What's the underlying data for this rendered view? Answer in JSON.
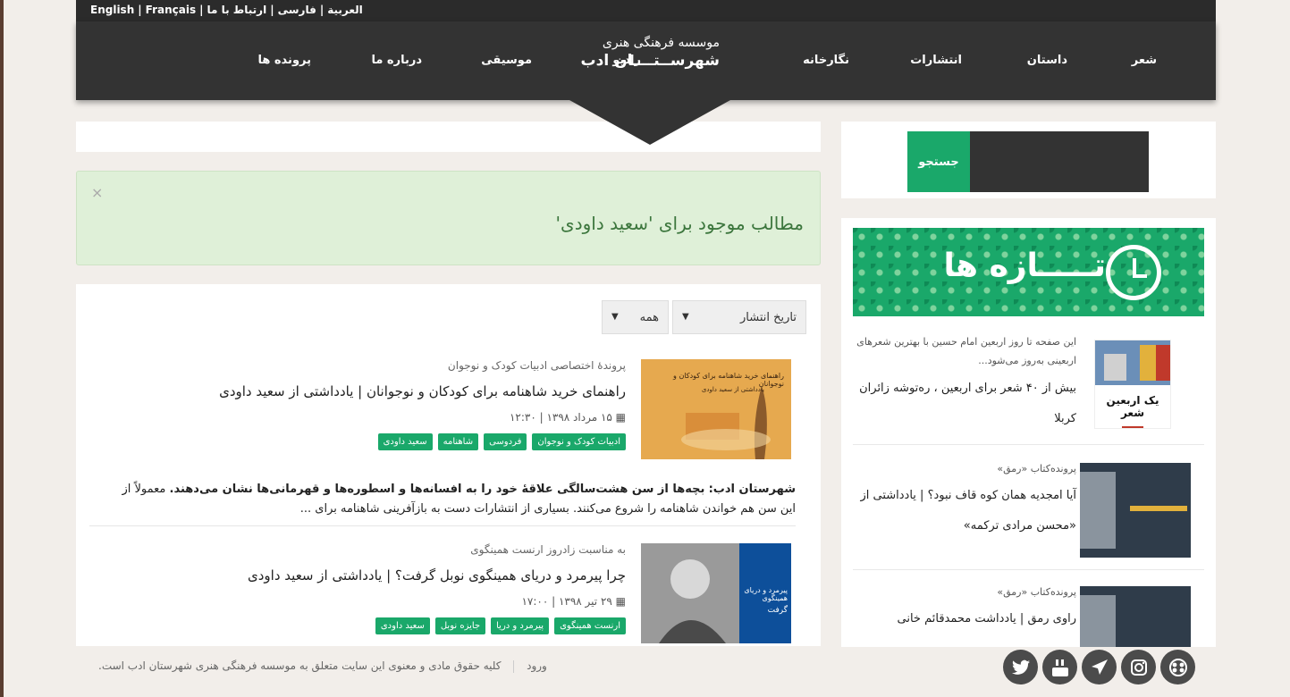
{
  "topbar": {
    "languages": [
      "English",
      "Français",
      "العربية",
      "فارسی"
    ],
    "contact": "ارتباط با ما"
  },
  "nav": {
    "items": [
      "شعر",
      "داستان",
      "انتشارات",
      "نگارخانه",
      "رادیو",
      "موسیقی",
      "درباره ما",
      "پرونده ها"
    ],
    "logo_line1": "موسسه فرهنگی هنری",
    "logo_line2": "شهرســتــــان ادب"
  },
  "search": {
    "button_label": "جستجو"
  },
  "alert": {
    "close": "×",
    "message": "مطالب موجود برای 'سعید داودی'"
  },
  "filters": {
    "sort": "تاریخ انتشار",
    "category": "همه"
  },
  "articles": [
    {
      "category": "پروندۀ اختصاصی ادبیات کودک و نوجوان",
      "title": "راهنمای خرید شاهنامه برای کودکان و نوجوانان | یادداشتی از سعید داودی",
      "date": "۱۵ مرداد ۱۳۹۸ | ۱۲:۳۰",
      "tags": [
        "ادبیات کودک و نوجوان",
        "فردوسی",
        "شاهنامه",
        "سعید داودی"
      ],
      "thumb_caption_1": "راهنمای خرید شاهنامه برای کودکان و نوجوانان",
      "thumb_caption_2": "یادداشتی از سعید داودی",
      "excerpt_lead": "شهرستان ادب:",
      "excerpt_bold": "بچه‌ها از سن هشت‌سالگی علاقهٔ خود را به افسانه‌ها و اسطوره‌ها و قهرمانی‌ها نشان می‌دهند.",
      "excerpt_rest": "معمولاً از این سن هم خواندن شاهنامه را شروع می‌کنند. بسیاری از انتشارات دست به بازآفرینی شاهنامه برای ..."
    },
    {
      "category": "به مناسبت زادروز ارنست همینگوی",
      "title": "چرا پیرمرد و دریای همینگوی نوبل گرفت؟ | یادداشتی از سعید داودی",
      "date": "۲۹ تیر ۱۳۹۸ | ۱۷:۰۰",
      "tags": [
        "ارنست همینگوی",
        "پیرمرد و دریا",
        "جایزه نوبل",
        "سعید داودی"
      ],
      "thumb_caption_1": "پیرمرد و دریای همینگوی",
      "thumb_caption_2": "گرفت"
    }
  ],
  "recent": {
    "banner_title": "تـــــازه ها",
    "items": [
      {
        "summary": "این صفحه تا روز اربعین امام حسین با بهترین شعرهای اربعینی به‌روز می‌شود...",
        "title": "بیش از ۴۰ شعر برای اربعین ، رەتوشه زائران کربلا",
        "thumb_text": "یک اربعین شعر"
      },
      {
        "category": "پرونده‌کتاب «رمق»",
        "title": "آیا امجدیه همان کوه قاف نبود؟ | یادداشتی از «محسن مرادی ترکمه»"
      },
      {
        "category": "پرونده‌کتاب «رمق»",
        "title": "راوی رمق | یادداشت محمدقائم خانی"
      }
    ]
  },
  "footer": {
    "login": "ورود",
    "copyright": "کلیه حقوق مادی و معنوی این سایت متعلق به موسسه فرهنگی هنری شهرستان ادب است."
  },
  "socials": [
    "twitter-icon",
    "youtube-icon",
    "telegram-icon",
    "instagram-icon",
    "aparat-icon"
  ],
  "colors": {
    "accent_green": "#1aa86a",
    "nav_dark": "#333333",
    "alert_bg": "#dff0d8",
    "alert_text": "#3c763d"
  }
}
